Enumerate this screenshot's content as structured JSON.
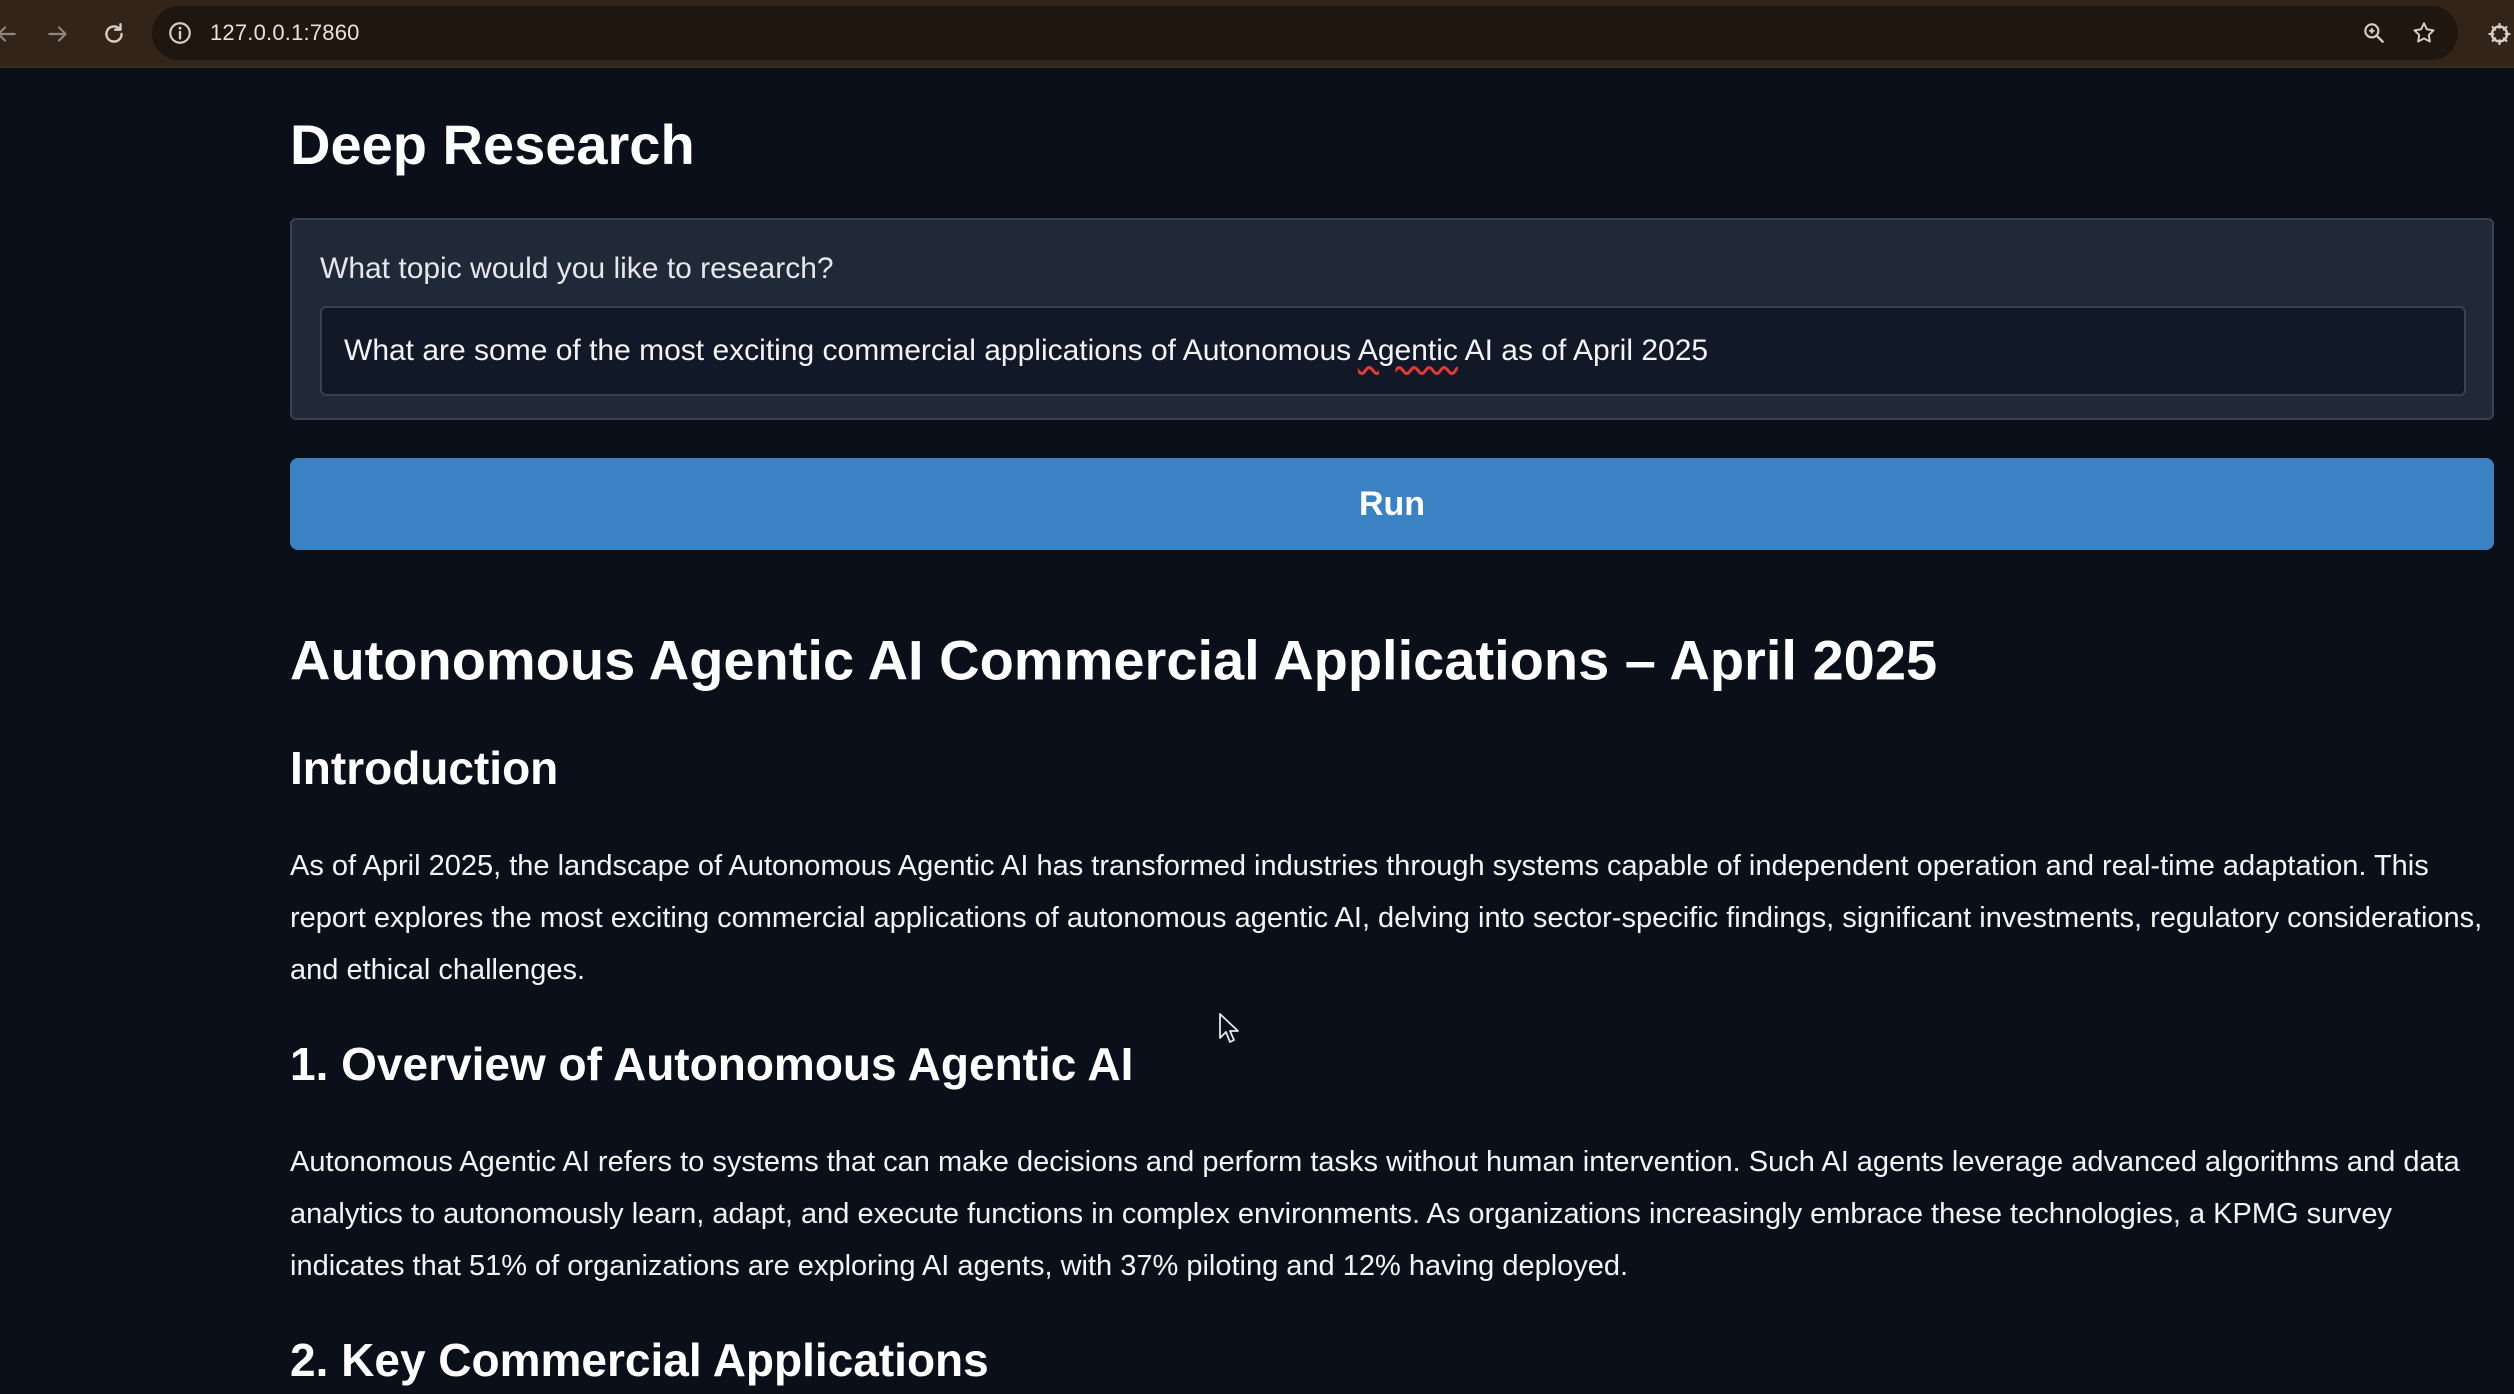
{
  "browser": {
    "url": "127.0.0.1:7860",
    "icons": [
      "back-icon",
      "forward-icon",
      "reload-icon",
      "site-info-icon",
      "zoom-icon",
      "bookmark-star-icon",
      "extension-icon"
    ]
  },
  "app": {
    "title": "Deep Research",
    "input_label": "What topic would you like to research?",
    "input_value_before": "What are some of the most exciting commercial applications of Autonomous ",
    "input_value_flagged": "Agentic",
    "input_value_after": " AI as of April 2025",
    "run_label": "Run",
    "accent_color": "#3b82c4"
  },
  "report": {
    "title": "Autonomous Agentic AI Commercial Applications – April 2025",
    "intro_heading": "Introduction",
    "intro_text": "As of April 2025, the landscape of Autonomous Agentic AI has transformed industries through systems capable of independent operation and real-time adaptation. This report explores the most exciting commercial applications of autonomous agentic AI, delving into sector-specific findings, significant investments, regulatory considerations, and ethical challenges.",
    "section1_heading": "1. Overview of Autonomous Agentic AI",
    "section1_text": "Autonomous Agentic AI refers to systems that can make decisions and perform tasks without human intervention. Such AI agents leverage advanced algorithms and data analytics to autonomously learn, adapt, and execute functions in complex environments. As organizations increasingly embrace these technologies, a KPMG survey indicates that 51% of organizations are exploring AI agents, with 37% piloting and 12% having deployed.",
    "section2_heading": "2. Key Commercial Applications"
  }
}
